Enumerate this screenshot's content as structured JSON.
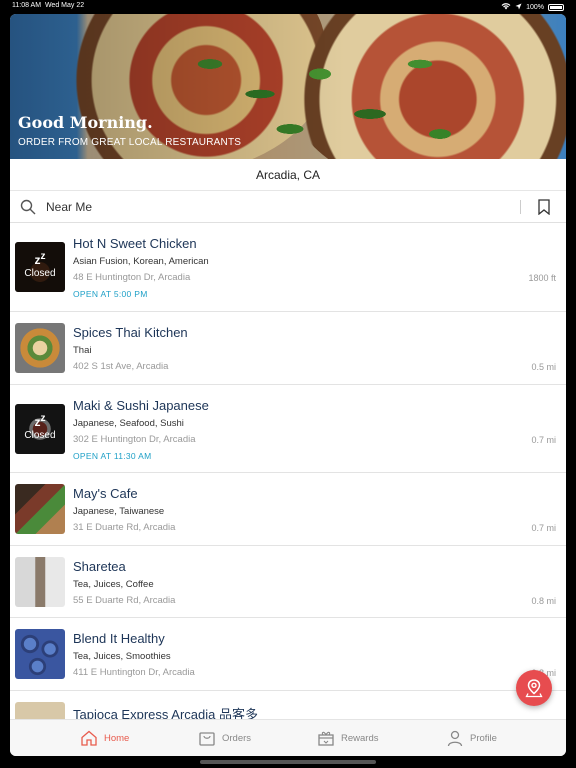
{
  "status_bar": {
    "time": "11:08 AM",
    "date": "Wed May 22",
    "battery": "100%"
  },
  "hero": {
    "greeting": "Good Morning.",
    "subtitle": "ORDER FROM GREAT LOCAL RESTAURANTS"
  },
  "location": "Arcadia, CA",
  "search": {
    "placeholder": "Near Me"
  },
  "restaurants": [
    {
      "name": "Hot N Sweet Chicken",
      "cuisine": "Asian Fusion, Korean, American",
      "address": "48 E Huntington Dr, Arcadia",
      "open_note": "OPEN AT 5:00 PM",
      "distance": "1800 ft",
      "closed": true,
      "closed_label": "Closed"
    },
    {
      "name": "Spices Thai Kitchen",
      "cuisine": "Thai",
      "address": "402 S 1st Ave, Arcadia",
      "open_note": "",
      "distance": "0.5 mi",
      "closed": false
    },
    {
      "name": "Maki & Sushi Japanese",
      "cuisine": "Japanese, Seafood, Sushi",
      "address": "302 E Huntington Dr, Arcadia",
      "open_note": "OPEN AT 11:30 AM",
      "distance": "0.7 mi",
      "closed": true,
      "closed_label": "Closed"
    },
    {
      "name": "May's Cafe",
      "cuisine": "Japanese, Taiwanese",
      "address": "31 E Duarte Rd, Arcadia",
      "open_note": "",
      "distance": "0.7 mi",
      "closed": false
    },
    {
      "name": "Sharetea",
      "cuisine": "Tea, Juices, Coffee",
      "address": "55 E Duarte Rd, Arcadia",
      "open_note": "",
      "distance": "0.8 mi",
      "closed": false
    },
    {
      "name": "Blend It Healthy",
      "cuisine": "Tea, Juices, Smoothies",
      "address": "411 E Huntington Dr, Arcadia",
      "open_note": "",
      "distance": "0.8 mi",
      "closed": false
    },
    {
      "name": "Tapioca Express Arcadia 品客多",
      "cuisine": "",
      "address": "",
      "open_note": "",
      "distance": "",
      "closed": false
    }
  ],
  "tabs": [
    {
      "label": "Home",
      "icon": "home-icon",
      "active": true
    },
    {
      "label": "Orders",
      "icon": "shopping-bag-icon",
      "active": false
    },
    {
      "label": "Rewards",
      "icon": "gift-icon",
      "active": false
    },
    {
      "label": "Profile",
      "icon": "person-icon",
      "active": false
    }
  ],
  "colors": {
    "accent": "#e85b4d",
    "open_text": "#1fa0c7",
    "name_text": "#1d3557",
    "fab": "#e74c4f"
  }
}
